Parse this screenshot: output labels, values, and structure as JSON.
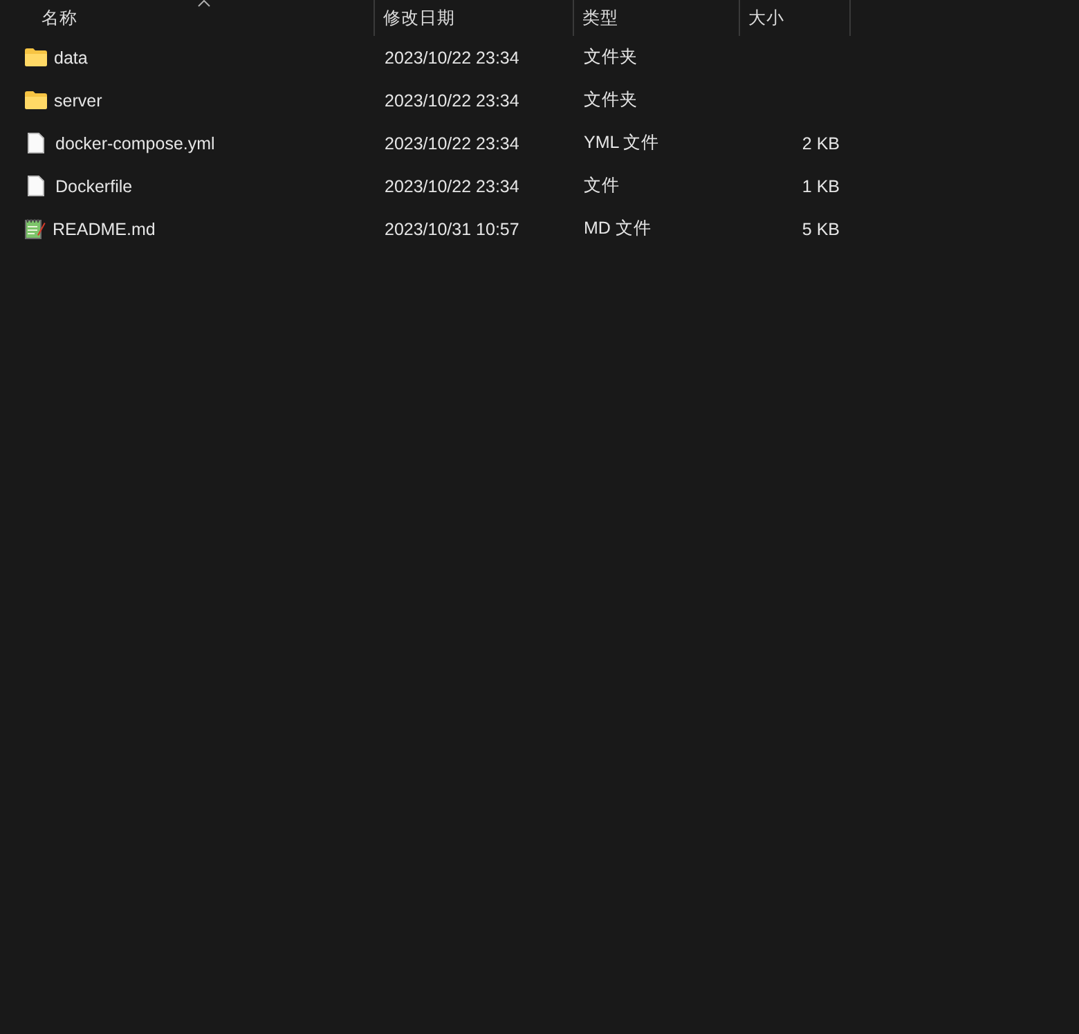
{
  "columns": [
    {
      "label": "名称",
      "sorted": true
    },
    {
      "label": "修改日期",
      "sorted": false
    },
    {
      "label": "类型",
      "sorted": false
    },
    {
      "label": "大小",
      "sorted": false
    }
  ],
  "rows": [
    {
      "kind": "folder",
      "name": "data",
      "modified": "2023/10/22 23:34",
      "type": "文件夹"
    },
    {
      "kind": "folder",
      "name": "server",
      "modified": "2023/10/22 23:34",
      "type": "文件夹"
    },
    {
      "kind": "file",
      "name": "docker-compose.yml",
      "modified": "2023/10/22 23:34",
      "type": "YML 文件",
      "size": "2 KB"
    },
    {
      "kind": "file",
      "name": "Dockerfile",
      "modified": "2023/10/22 23:34",
      "type": "文件",
      "size": "1 KB"
    },
    {
      "kind": "note",
      "name": "README.md",
      "modified": "2023/10/31 10:57",
      "type": "MD 文件",
      "size": "5 KB"
    }
  ]
}
